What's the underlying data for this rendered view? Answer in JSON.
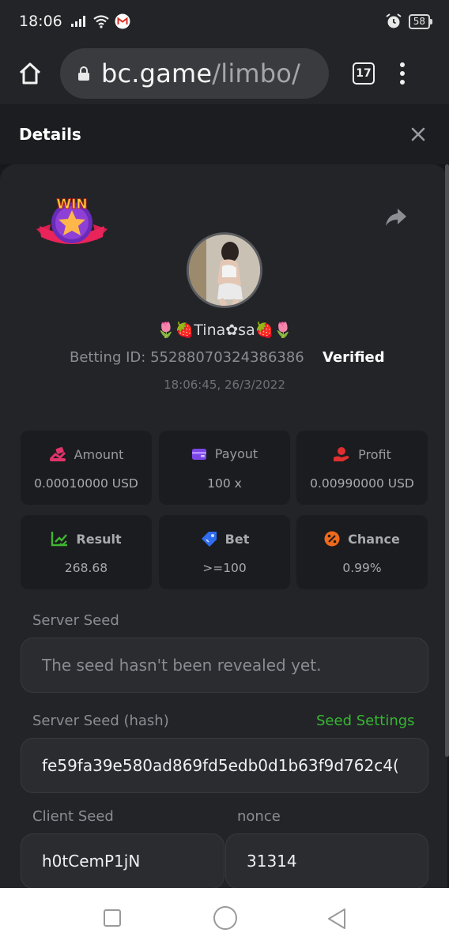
{
  "status_bar": {
    "time": "18:06",
    "battery": "58"
  },
  "browser": {
    "url_domain": "bc.game",
    "url_path": "/limbo/",
    "tab_count": "17"
  },
  "details": {
    "title": "Details"
  },
  "bet": {
    "username": "🌷🍓Tina✿sa🍓🌷",
    "betting_id_label": "Betting ID:",
    "betting_id": "55288070324386386",
    "verified_label": "Verified",
    "timestamp": "18:06:45, 26/3/2022"
  },
  "stats": [
    {
      "label": "Amount",
      "value": "0.00010000 USD",
      "icon": "money-hand-icon",
      "color": "#e0346a"
    },
    {
      "label": "Payout",
      "value": "100 x",
      "icon": "wallet-icon",
      "color": "#7c46e6"
    },
    {
      "label": "Profit",
      "value": "0.00990000 USD",
      "icon": "coin-hand-icon",
      "color": "#e02f2f"
    },
    {
      "label": "Result",
      "value": "268.68",
      "icon": "chart-check-icon",
      "color": "#3fb632"
    },
    {
      "label": "Bet",
      "value": ">=100",
      "icon": "ticket-icon",
      "color": "#2f6cf0"
    },
    {
      "label": "Chance",
      "value": "0.99%",
      "icon": "percent-icon",
      "color": "#ef6a1a"
    }
  ],
  "seeds": {
    "server_seed_label": "Server Seed",
    "server_seed_value": "The seed hasn't been revealed yet.",
    "server_hash_label": "Server Seed (hash)",
    "seed_settings_link": "Seed Settings",
    "server_hash_value": "fe59fa39e580ad869fd5edb0d1b63f9d762c4(",
    "client_seed_label": "Client Seed",
    "client_seed_value": "h0tCemP1jN",
    "nonce_label": "nonce",
    "nonce_value": "31314"
  },
  "badge": {
    "text": "WIN"
  }
}
